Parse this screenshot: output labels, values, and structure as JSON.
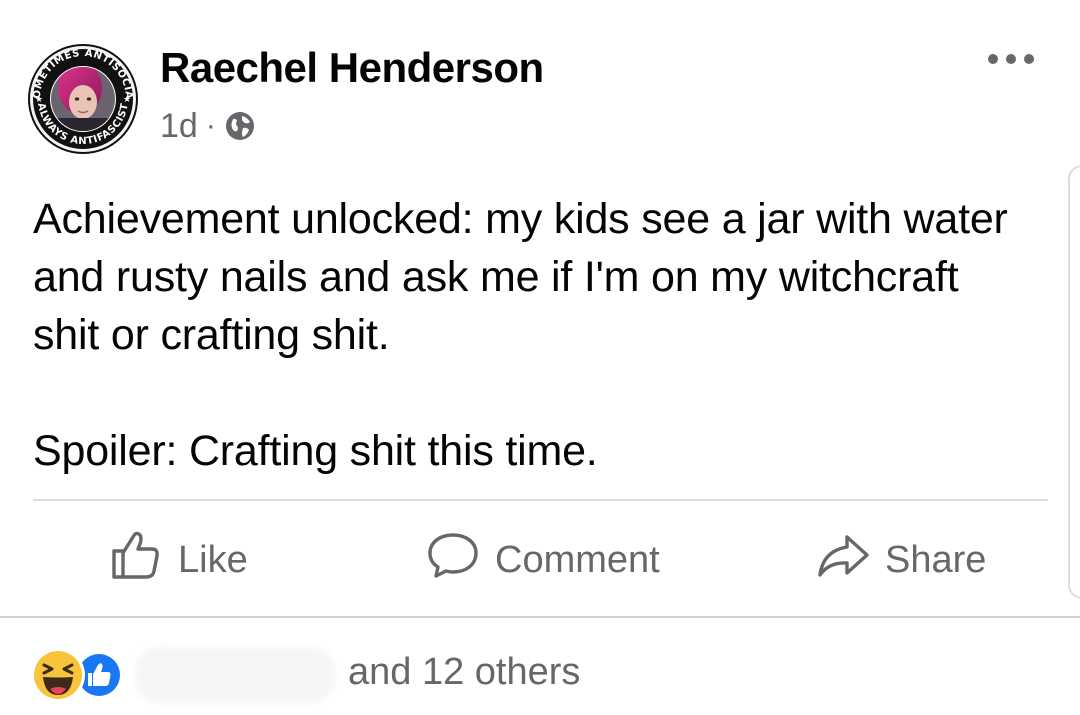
{
  "post": {
    "author": "Raechel Henderson",
    "time": "1d",
    "separator": "·",
    "privacy_icon": "globe-icon",
    "avatar_ring_text": {
      "top": "SOMETIMES ANTISOCIAL",
      "bottom": "ALWAYS ANTIFASCIST"
    },
    "text_paragraphs": [
      "Achievement unlocked: my kids see a jar with water and rusty nails and ask me if I'm on my witchcraft shit or crafting shit.",
      "Spoiler: Crafting shit this time."
    ]
  },
  "actions": {
    "like_label": "Like",
    "comment_label": "Comment",
    "share_label": "Share"
  },
  "reactions": {
    "icons": [
      "haha-reaction-icon",
      "like-reaction-icon"
    ],
    "others_text": "and 12 others"
  },
  "colors": {
    "text_primary": "#050505",
    "text_secondary": "#65676b",
    "facebook_blue": "#1877f2",
    "divider": "#ced0d4",
    "haha_yellow": "#f7c43a"
  }
}
